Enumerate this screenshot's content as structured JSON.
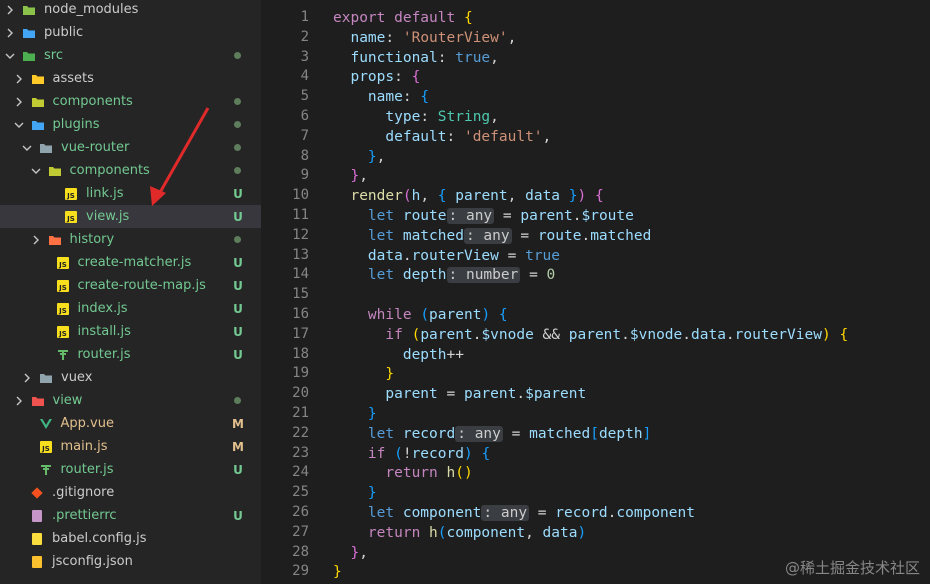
{
  "explorer": {
    "items": [
      {
        "label": "node_modules",
        "kind": "folder",
        "icon": "node-folder-icon",
        "color": "#cccccc",
        "badge": "",
        "dot": false
      },
      {
        "label": "public",
        "kind": "folder",
        "icon": "public-folder-icon",
        "color": "#cccccc",
        "badge": "",
        "dot": false
      },
      {
        "label": "src",
        "kind": "folder",
        "icon": "src-folder-icon",
        "color": "#73c991",
        "badge": "",
        "dot": true
      },
      {
        "label": "assets",
        "kind": "folder",
        "icon": "assets-folder-icon",
        "color": "#cccccc",
        "badge": "",
        "dot": false
      },
      {
        "label": "components",
        "kind": "folder",
        "icon": "components-folder-icon",
        "color": "#73c991",
        "badge": "",
        "dot": true
      },
      {
        "label": "plugins",
        "kind": "folder",
        "icon": "plugins-folder-icon",
        "color": "#73c991",
        "badge": "",
        "dot": true
      },
      {
        "label": "vue-router",
        "kind": "folder",
        "icon": "folder-icon",
        "color": "#73c991",
        "badge": "",
        "dot": true
      },
      {
        "label": "components",
        "kind": "folder",
        "icon": "components-folder-icon",
        "color": "#73c991",
        "badge": "",
        "dot": true
      },
      {
        "label": "link.js",
        "kind": "file",
        "icon": "js-file-icon",
        "color": "#73c991",
        "badge": "U",
        "dot": false
      },
      {
        "label": "view.js",
        "kind": "file",
        "icon": "js-file-icon",
        "color": "#73c991",
        "badge": "U",
        "dot": false
      },
      {
        "label": "history",
        "kind": "folder",
        "icon": "history-folder-icon",
        "color": "#73c991",
        "badge": "",
        "dot": true
      },
      {
        "label": "create-matcher.js",
        "kind": "file",
        "icon": "js-file-icon",
        "color": "#73c991",
        "badge": "U",
        "dot": false
      },
      {
        "label": "create-route-map.js",
        "kind": "file",
        "icon": "js-file-icon",
        "color": "#73c991",
        "badge": "U",
        "dot": false
      },
      {
        "label": "index.js",
        "kind": "file",
        "icon": "js-file-icon",
        "color": "#73c991",
        "badge": "U",
        "dot": false
      },
      {
        "label": "install.js",
        "kind": "file",
        "icon": "js-file-icon",
        "color": "#73c991",
        "badge": "U",
        "dot": false
      },
      {
        "label": "router.js",
        "kind": "file",
        "icon": "router-file-icon",
        "color": "#73c991",
        "badge": "U",
        "dot": false
      },
      {
        "label": "vuex",
        "kind": "folder",
        "icon": "folder-icon",
        "color": "#cccccc",
        "badge": "",
        "dot": false
      },
      {
        "label": "view",
        "kind": "folder",
        "icon": "view-folder-icon",
        "color": "#73c991",
        "badge": "",
        "dot": true
      },
      {
        "label": "App.vue",
        "kind": "file",
        "icon": "vue-file-icon",
        "color": "#e2c08d",
        "badge": "M",
        "dot": false
      },
      {
        "label": "main.js",
        "kind": "file",
        "icon": "js-file-icon",
        "color": "#e2c08d",
        "badge": "M",
        "dot": false
      },
      {
        "label": "router.js",
        "kind": "file",
        "icon": "router-file-icon",
        "color": "#73c991",
        "badge": "U",
        "dot": false
      },
      {
        "label": ".gitignore",
        "kind": "file",
        "icon": "git-file-icon",
        "color": "#cccccc",
        "badge": "",
        "dot": false
      },
      {
        "label": ".prettierrc",
        "kind": "file",
        "icon": "prettier-file-icon",
        "color": "#73c991",
        "badge": "U",
        "dot": false
      },
      {
        "label": "babel.config.js",
        "kind": "file",
        "icon": "babel-file-icon",
        "color": "#cccccc",
        "badge": "",
        "dot": false
      },
      {
        "label": "jsconfig.json",
        "kind": "file",
        "icon": "json-file-icon",
        "color": "#cccccc",
        "badge": "",
        "dot": false
      }
    ]
  },
  "editor": {
    "line_numbers": [
      "1",
      "2",
      "3",
      "4",
      "5",
      "6",
      "7",
      "8",
      "9",
      "10",
      "11",
      "12",
      "13",
      "14",
      "15",
      "16",
      "17",
      "18",
      "19",
      "20",
      "21",
      "22",
      "23",
      "24",
      "25",
      "26",
      "27",
      "28",
      "29"
    ],
    "lines": [
      [
        [
          "export default ",
          "kw"
        ],
        [
          "{",
          "br1"
        ]
      ],
      [
        [
          "  name",
          ""
        ],
        [
          ": ",
          "plain"
        ],
        [
          "'RouterView'",
          "str"
        ],
        [
          ",",
          "plain"
        ]
      ],
      [
        [
          "  functional",
          ""
        ],
        [
          ": ",
          "plain"
        ],
        [
          "true",
          "blue"
        ],
        [
          ",",
          "plain"
        ]
      ],
      [
        [
          "  props",
          ""
        ],
        [
          ": ",
          "plain"
        ],
        [
          "{",
          "br2"
        ]
      ],
      [
        [
          "    name",
          ""
        ],
        [
          ": ",
          "plain"
        ],
        [
          "{",
          "br3"
        ]
      ],
      [
        [
          "      type",
          ""
        ],
        [
          ": ",
          "plain"
        ],
        [
          "String",
          "type"
        ],
        [
          ",",
          "plain"
        ]
      ],
      [
        [
          "      default",
          ""
        ],
        [
          ": ",
          "plain"
        ],
        [
          "'default'",
          "str"
        ],
        [
          ",",
          "plain"
        ]
      ],
      [
        [
          "    ",
          "plain"
        ],
        [
          "}",
          "br3"
        ],
        [
          ",",
          "plain"
        ]
      ],
      [
        [
          "  ",
          "plain"
        ],
        [
          "}",
          "br2"
        ],
        [
          ",",
          "plain"
        ]
      ],
      [
        [
          "  render",
          "fn"
        ],
        [
          "(",
          "br2"
        ],
        [
          "h",
          "prop"
        ],
        [
          ", ",
          "plain"
        ],
        [
          "{ ",
          "br3"
        ],
        [
          "parent",
          "prop"
        ],
        [
          ", ",
          "plain"
        ],
        [
          "data",
          "prop"
        ],
        [
          " }",
          "br3"
        ],
        [
          ")",
          "br2"
        ],
        [
          " ",
          "plain"
        ],
        [
          "{",
          "br2"
        ]
      ],
      [
        [
          "    let ",
          "blue"
        ],
        [
          "route",
          "prop"
        ],
        [
          ": any",
          "hint"
        ],
        [
          " = ",
          "plain"
        ],
        [
          "parent",
          "prop"
        ],
        [
          ".",
          "plain"
        ],
        [
          "$route",
          "prop"
        ]
      ],
      [
        [
          "    let ",
          "blue"
        ],
        [
          "matched",
          "prop"
        ],
        [
          ": any",
          "hint"
        ],
        [
          " = ",
          "plain"
        ],
        [
          "route",
          "prop"
        ],
        [
          ".",
          "plain"
        ],
        [
          "matched",
          "prop"
        ]
      ],
      [
        [
          "    data",
          "prop"
        ],
        [
          ".",
          "plain"
        ],
        [
          "routerView",
          "prop"
        ],
        [
          " = ",
          "plain"
        ],
        [
          "true",
          "blue"
        ]
      ],
      [
        [
          "    let ",
          "blue"
        ],
        [
          "depth",
          "prop"
        ],
        [
          ": number",
          "hint"
        ],
        [
          " = ",
          "plain"
        ],
        [
          "0",
          "num"
        ]
      ],
      [
        [
          "",
          "plain"
        ]
      ],
      [
        [
          "    while ",
          "kw"
        ],
        [
          "(",
          "br3"
        ],
        [
          "parent",
          "prop"
        ],
        [
          ")",
          "br3"
        ],
        [
          " ",
          "plain"
        ],
        [
          "{",
          "br3"
        ]
      ],
      [
        [
          "      if ",
          "kw"
        ],
        [
          "(",
          "br1"
        ],
        [
          "parent",
          "prop"
        ],
        [
          ".",
          "plain"
        ],
        [
          "$vnode",
          "prop"
        ],
        [
          " && ",
          "plain"
        ],
        [
          "parent",
          "prop"
        ],
        [
          ".",
          "plain"
        ],
        [
          "$vnode",
          "prop"
        ],
        [
          ".",
          "plain"
        ],
        [
          "data",
          "prop"
        ],
        [
          ".",
          "plain"
        ],
        [
          "routerView",
          "prop"
        ],
        [
          ")",
          "br1"
        ],
        [
          " ",
          "plain"
        ],
        [
          "{",
          "br1"
        ]
      ],
      [
        [
          "        depth",
          "prop"
        ],
        [
          "++",
          "plain"
        ]
      ],
      [
        [
          "      ",
          "plain"
        ],
        [
          "}",
          "br1"
        ]
      ],
      [
        [
          "      parent",
          "prop"
        ],
        [
          " = ",
          "plain"
        ],
        [
          "parent",
          "prop"
        ],
        [
          ".",
          "plain"
        ],
        [
          "$parent",
          "prop"
        ]
      ],
      [
        [
          "    ",
          "plain"
        ],
        [
          "}",
          "br3"
        ]
      ],
      [
        [
          "    let ",
          "blue"
        ],
        [
          "record",
          "prop"
        ],
        [
          ": any",
          "hint"
        ],
        [
          " = ",
          "plain"
        ],
        [
          "matched",
          "prop"
        ],
        [
          "[",
          "br3"
        ],
        [
          "depth",
          "prop"
        ],
        [
          "]",
          "br3"
        ]
      ],
      [
        [
          "    if ",
          "kw"
        ],
        [
          "(",
          "br3"
        ],
        [
          "!",
          "plain"
        ],
        [
          "record",
          "prop"
        ],
        [
          ")",
          "br3"
        ],
        [
          " ",
          "plain"
        ],
        [
          "{",
          "br3"
        ]
      ],
      [
        [
          "      return ",
          "kw"
        ],
        [
          "h",
          "fn"
        ],
        [
          "()",
          "br1"
        ]
      ],
      [
        [
          "    ",
          "plain"
        ],
        [
          "}",
          "br3"
        ]
      ],
      [
        [
          "    let ",
          "blue"
        ],
        [
          "component",
          "prop"
        ],
        [
          ": any",
          "hint"
        ],
        [
          " = ",
          "plain"
        ],
        [
          "record",
          "prop"
        ],
        [
          ".",
          "plain"
        ],
        [
          "component",
          "prop"
        ]
      ],
      [
        [
          "    return ",
          "kw"
        ],
        [
          "h",
          "fn"
        ],
        [
          "(",
          "br3"
        ],
        [
          "component",
          "prop"
        ],
        [
          ", ",
          "plain"
        ],
        [
          "data",
          "prop"
        ],
        [
          ")",
          "br3"
        ]
      ],
      [
        [
          "  ",
          "plain"
        ],
        [
          "}",
          "br2"
        ],
        [
          ",",
          "plain"
        ]
      ],
      [
        [
          "}",
          "br1"
        ]
      ]
    ]
  },
  "watermark": "@稀土掘金技术社区",
  "colors": {
    "accent_untracked": "#73c991",
    "modified": "#e2c08d",
    "arrow": "#e02a2a"
  }
}
